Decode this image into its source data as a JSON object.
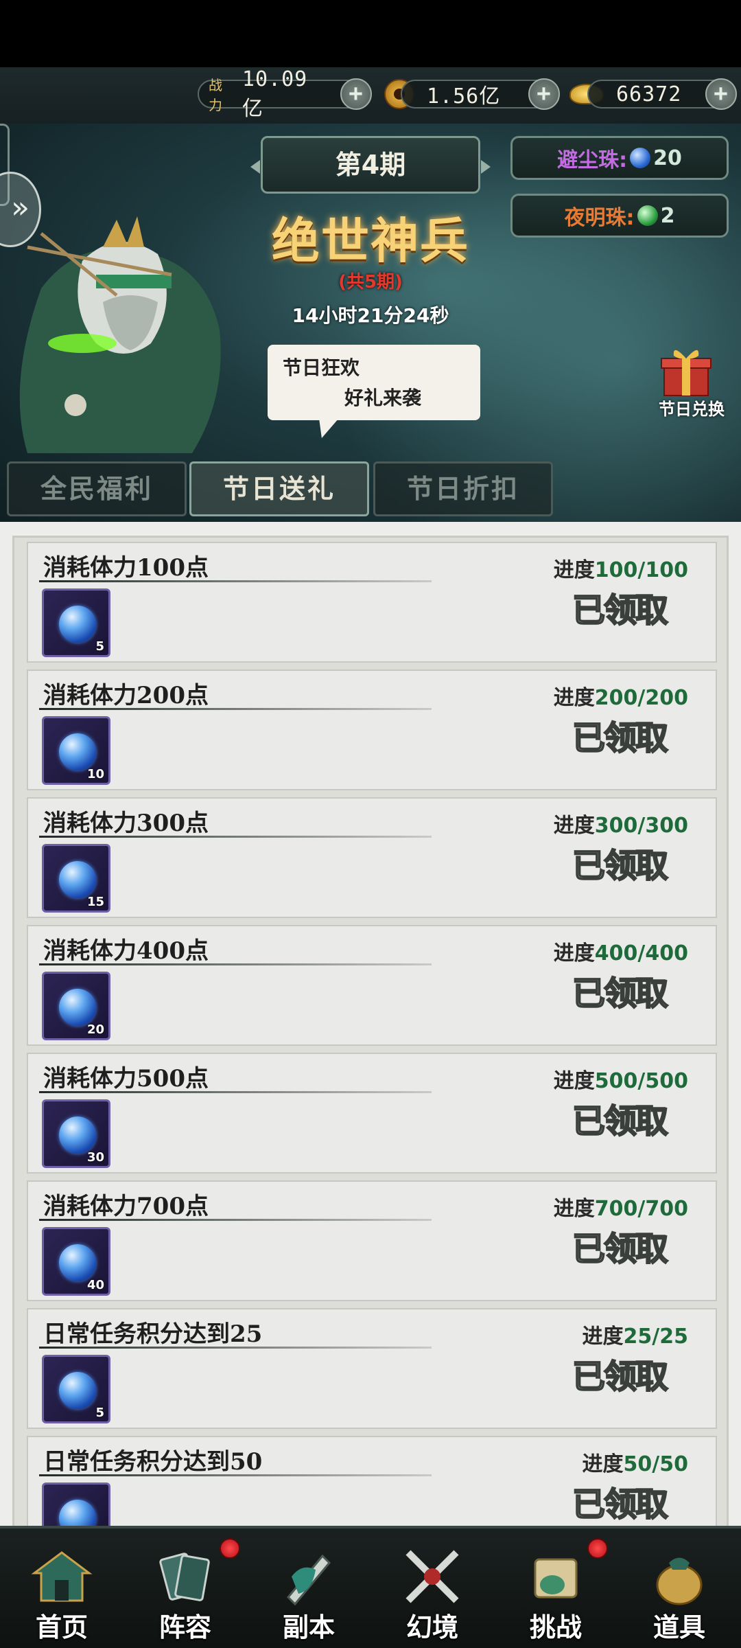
{
  "resources": {
    "power_label": "战力",
    "power_value": "10.09亿",
    "coin_value": "1.56亿",
    "ingot_value": "66372"
  },
  "banner": {
    "period": "第4期",
    "title": "绝世神兵",
    "subtitle": "(共5期)",
    "timer": "14小时21分24秒",
    "speech_line1": "节日狂欢",
    "speech_line2": "好礼来袭",
    "pearl1_name": "避尘珠:",
    "pearl1_count": "20",
    "pearl2_name": "夜明珠:",
    "pearl2_count": "2",
    "gift_label": "节日兑换",
    "colors": {
      "pearl1": "#c36be0",
      "pearl2": "#e87a34"
    }
  },
  "tabs": [
    {
      "label": "全民福利",
      "active": false
    },
    {
      "label": "节日送礼",
      "active": true
    },
    {
      "label": "节日折扣",
      "active": false
    }
  ],
  "tasks": [
    {
      "name": "消耗体力100点",
      "progress_label": "进度",
      "progress": "100/100",
      "reward_qty": "5",
      "status": "已领取"
    },
    {
      "name": "消耗体力200点",
      "progress_label": "进度",
      "progress": "200/200",
      "reward_qty": "10",
      "status": "已领取"
    },
    {
      "name": "消耗体力300点",
      "progress_label": "进度",
      "progress": "300/300",
      "reward_qty": "15",
      "status": "已领取"
    },
    {
      "name": "消耗体力400点",
      "progress_label": "进度",
      "progress": "400/400",
      "reward_qty": "20",
      "status": "已领取"
    },
    {
      "name": "消耗体力500点",
      "progress_label": "进度",
      "progress": "500/500",
      "reward_qty": "30",
      "status": "已领取"
    },
    {
      "name": "消耗体力700点",
      "progress_label": "进度",
      "progress": "700/700",
      "reward_qty": "40",
      "status": "已领取"
    },
    {
      "name": "日常任务积分达到25",
      "progress_label": "进度",
      "progress": "25/25",
      "reward_qty": "5",
      "status": "已领取"
    },
    {
      "name": "日常任务积分达到50",
      "progress_label": "进度",
      "progress": "50/50",
      "reward_qty": "",
      "status": "已领取"
    }
  ],
  "nav": [
    {
      "label": "首页",
      "icon": "home-icon",
      "badge": false
    },
    {
      "label": "阵容",
      "icon": "lineup-icon",
      "badge": true
    },
    {
      "label": "副本",
      "icon": "dungeon-icon",
      "badge": false
    },
    {
      "label": "幻境",
      "icon": "illusion-icon",
      "badge": false
    },
    {
      "label": "挑战",
      "icon": "challenge-icon",
      "badge": true
    },
    {
      "label": "道具",
      "icon": "items-icon",
      "badge": false
    }
  ]
}
